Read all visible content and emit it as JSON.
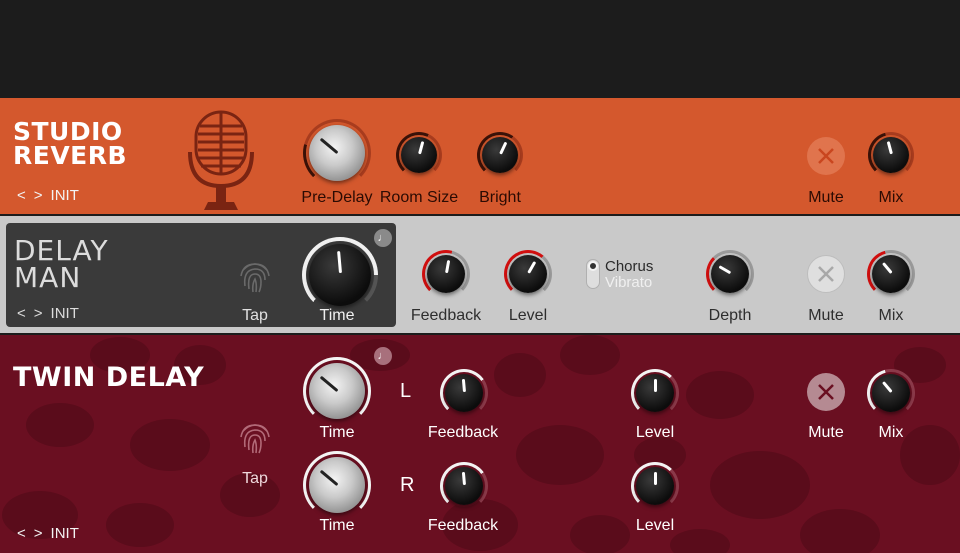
{
  "studio_reverb": {
    "title_line1": "STUDIO",
    "title_line2": "REVERB",
    "preset_prev": "<",
    "preset_next": ">",
    "preset": "INIT",
    "knobs": {
      "pre_delay": "Pre-Delay",
      "room_size": "Room Size",
      "bright": "Bright",
      "mix": "Mix"
    },
    "mute": "Mute",
    "accent": "#d4582d"
  },
  "delay_man": {
    "title_line1": "DELAY",
    "title_line2": "MAN",
    "preset_prev": "<",
    "preset_next": ">",
    "preset": "INIT",
    "tap": "Tap",
    "time": "Time",
    "knobs": {
      "feedback": "Feedback",
      "level": "Level",
      "depth": "Depth",
      "mix": "Mix"
    },
    "mode_options": [
      "Chorus",
      "Vibrato"
    ],
    "mode_selected": "Chorus",
    "mute": "Mute",
    "accent": "#d10f0f"
  },
  "twin_delay": {
    "title": "TWIN DELAY",
    "preset_prev": "<",
    "preset_next": ">",
    "preset": "INIT",
    "tap": "Tap",
    "left": {
      "channel": "L",
      "time": "Time",
      "feedback": "Feedback",
      "level": "Level"
    },
    "right": {
      "channel": "R",
      "time": "Time",
      "feedback": "Feedback",
      "level": "Level"
    },
    "mute": "Mute",
    "mix": "Mix",
    "accent": "#6a0f21"
  }
}
